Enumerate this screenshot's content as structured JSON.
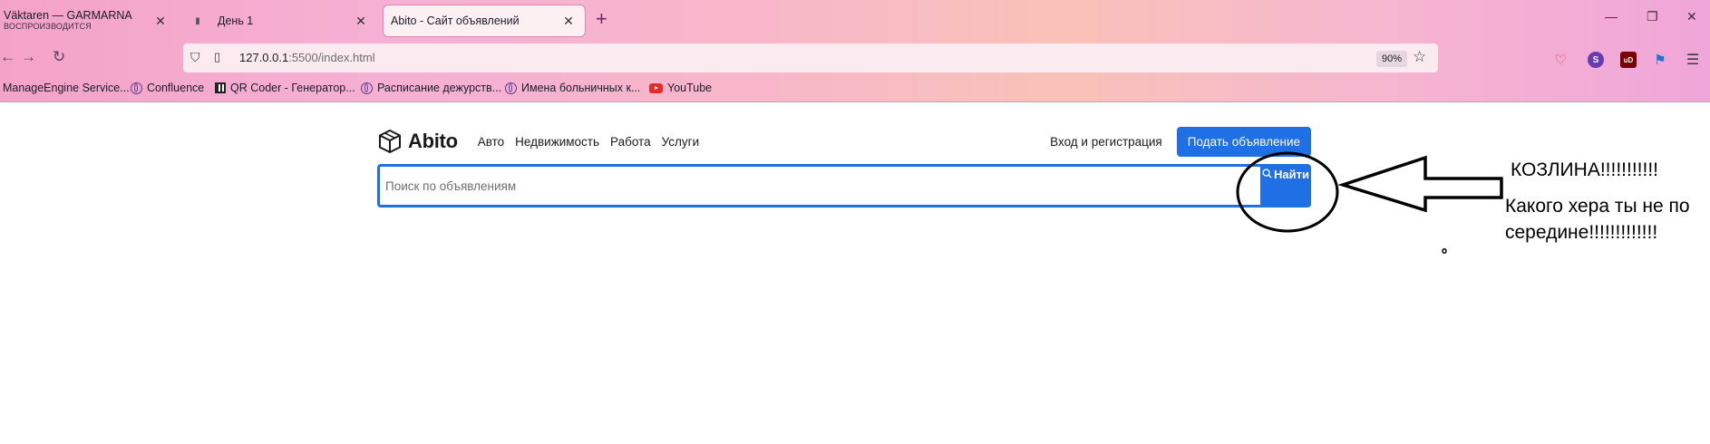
{
  "browser": {
    "tabs": [
      {
        "title": "Väktaren — GARMARNA",
        "subtitle": "ВОСПРОИЗВОДИТСЯ",
        "active": false
      },
      {
        "title": "День 1",
        "active": false
      },
      {
        "title": "Abito - Сайт объявлений",
        "active": true
      }
    ],
    "url": {
      "host": "127.0.0.1",
      "rest": ":5500/index.html"
    },
    "zoom": "90%",
    "bookmarks": [
      {
        "label": "ManageEngine Service...",
        "icon": "none"
      },
      {
        "label": "Confluence",
        "icon": "globe-icon"
      },
      {
        "label": "QR Coder - Генератор...",
        "icon": "qr-icon"
      },
      {
        "label": "Расписание дежурств...",
        "icon": "globe-icon"
      },
      {
        "label": "Имена больничных к...",
        "icon": "globe-icon"
      },
      {
        "label": "YouTube",
        "icon": "youtube-icon"
      }
    ],
    "extensions": [
      {
        "name": "pocket-icon",
        "color": "#d23a5a"
      },
      {
        "name": "profile-s-icon",
        "label": "S",
        "color": "#6a3ab5"
      },
      {
        "name": "ublock-icon",
        "label": "uD",
        "color": "#7a0000"
      },
      {
        "name": "vpn-icon",
        "color": "#1a74d8"
      }
    ]
  },
  "page": {
    "logo": "Abito",
    "nav": [
      "Авто",
      "Недвижимость",
      "Работа",
      "Услуги"
    ],
    "login_label": "Вход и регистрация",
    "post_button_label": "Подать объявление",
    "search": {
      "placeholder": "Поиск по объявлениям",
      "button_label": "Найти"
    },
    "accent_color": "#1f6fe5"
  },
  "annotation": {
    "title": "КОЗЛИНА!!!!!!!!!!!",
    "body": "Какого хера ты не по середине!!!!!!!!!!!!!"
  }
}
